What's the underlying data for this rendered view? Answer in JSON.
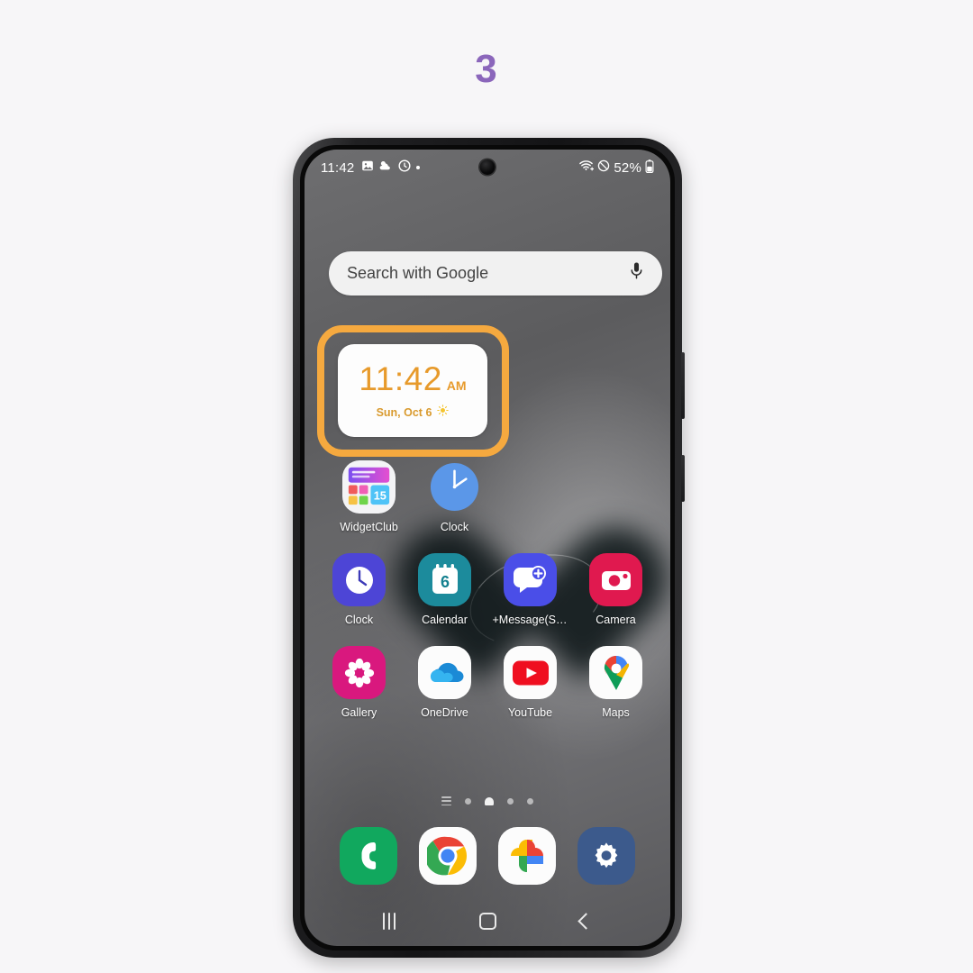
{
  "step": {
    "number": "3"
  },
  "colors": {
    "page_background": "#f7f6f8",
    "step_number": "#8b66bb",
    "highlight_border": "#f5a93f",
    "widget_accent": "#e79a2b"
  },
  "status_bar": {
    "time": "11:42",
    "battery_percent": "52%",
    "icons": [
      "image-icon",
      "weather-cloud-icon",
      "alarm-circle-icon",
      "dot-icon",
      "wifi-icon",
      "do-not-disturb-icon",
      "battery-icon"
    ]
  },
  "search": {
    "placeholder": "Search with Google",
    "mic_icon": "microphone-icon"
  },
  "clock_widget": {
    "time": "11:42",
    "ampm": "AM",
    "date": "Sun, Oct 6",
    "weather_icon": "sun-icon",
    "highlighted": "true"
  },
  "apps": {
    "row1": [
      {
        "label": "WidgetClub",
        "icon": "widgetclub-icon"
      },
      {
        "label": "Clock",
        "icon": "clock-blue-icon"
      }
    ],
    "row2": [
      {
        "label": "Clock",
        "icon": "clock-indigo-icon"
      },
      {
        "label": "Calendar",
        "icon": "calendar-icon",
        "badge": "6"
      },
      {
        "label": "+Message(SM...",
        "icon": "message-plus-icon"
      },
      {
        "label": "Camera",
        "icon": "camera-icon"
      }
    ],
    "row3": [
      {
        "label": "Gallery",
        "icon": "gallery-flower-icon"
      },
      {
        "label": "OneDrive",
        "icon": "onedrive-cloud-icon"
      },
      {
        "label": "YouTube",
        "icon": "youtube-play-icon"
      },
      {
        "label": "Maps",
        "icon": "maps-pin-icon"
      }
    ]
  },
  "page_indicator": {
    "items": [
      "apps-list-icon",
      "page-dot",
      "home-page-active",
      "page-dot",
      "page-dot"
    ],
    "active_index": "2"
  },
  "dock": [
    {
      "label": "Phone",
      "icon": "phone-icon"
    },
    {
      "label": "Chrome",
      "icon": "chrome-icon"
    },
    {
      "label": "Photos",
      "icon": "google-photos-icon"
    },
    {
      "label": "Settings",
      "icon": "settings-gear-icon"
    }
  ],
  "nav_bar": {
    "recents_label": "Recents",
    "home_label": "Home",
    "back_label": "Back"
  }
}
